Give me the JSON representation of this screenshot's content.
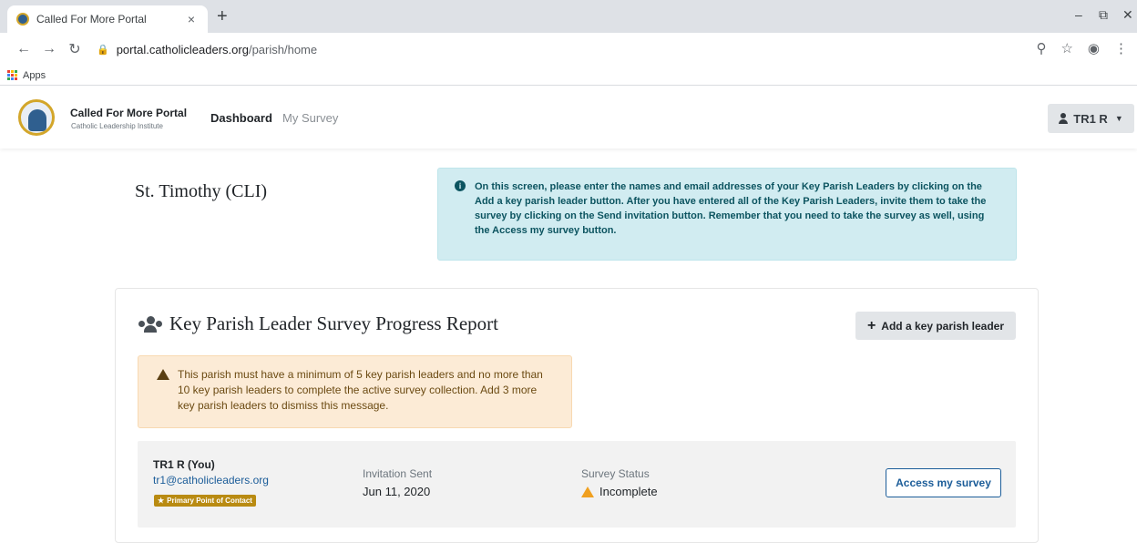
{
  "browser": {
    "tab_title": "Called For More Portal",
    "tab_close": "×",
    "new_tab": "+",
    "url_host": "portal.catholicleaders.org",
    "url_path": "/parish/home",
    "bookmark_apps": "Apps",
    "icons": [
      "back-arrow-icon",
      "forward-arrow-icon",
      "reload-icon",
      "lock-icon",
      "key-icon",
      "star-icon",
      "account-icon",
      "kebab-menu-icon"
    ]
  },
  "header": {
    "brand_title": "Called For More Portal",
    "brand_subtitle": "Catholic Leadership Institute",
    "nav": {
      "dashboard": "Dashboard",
      "my_survey": "My Survey"
    },
    "user_label": "TR1 R"
  },
  "main": {
    "parish_name": "St. Timothy (CLI)",
    "info_message": "On this screen, please enter the names and email addresses of your Key Parish Leaders by clicking on the Add a key parish leader button. After you have entered all of the Key Parish Leaders, invite them to take the survey by clicking on the Send invitation button. Remember that you need to take the survey as well, using the Access my survey button.",
    "report": {
      "title": "Key Parish Leader Survey Progress Report",
      "add_button": "Add a key parish leader",
      "warning": "This parish must have a minimum of 5 key parish leaders and no more than 10 key parish leaders to complete the active survey collection. Add 3 more key parish leaders to dismiss this message.",
      "leaders": [
        {
          "name": "TR1 R (You)",
          "email": "tr1@catholicleaders.org",
          "badge": "Primary Point of Contact",
          "invitation_label": "Invitation Sent",
          "invitation_date": "Jun 11, 2020",
          "status_label": "Survey Status",
          "status_value": "Incomplete",
          "action": "Access my survey"
        }
      ]
    }
  },
  "colors": {
    "info_bg": "#d1ecf1",
    "warning_bg": "#fcebd6",
    "link": "#1c5d99",
    "badge": "#b98b12",
    "status_warning": "#f0a020"
  }
}
